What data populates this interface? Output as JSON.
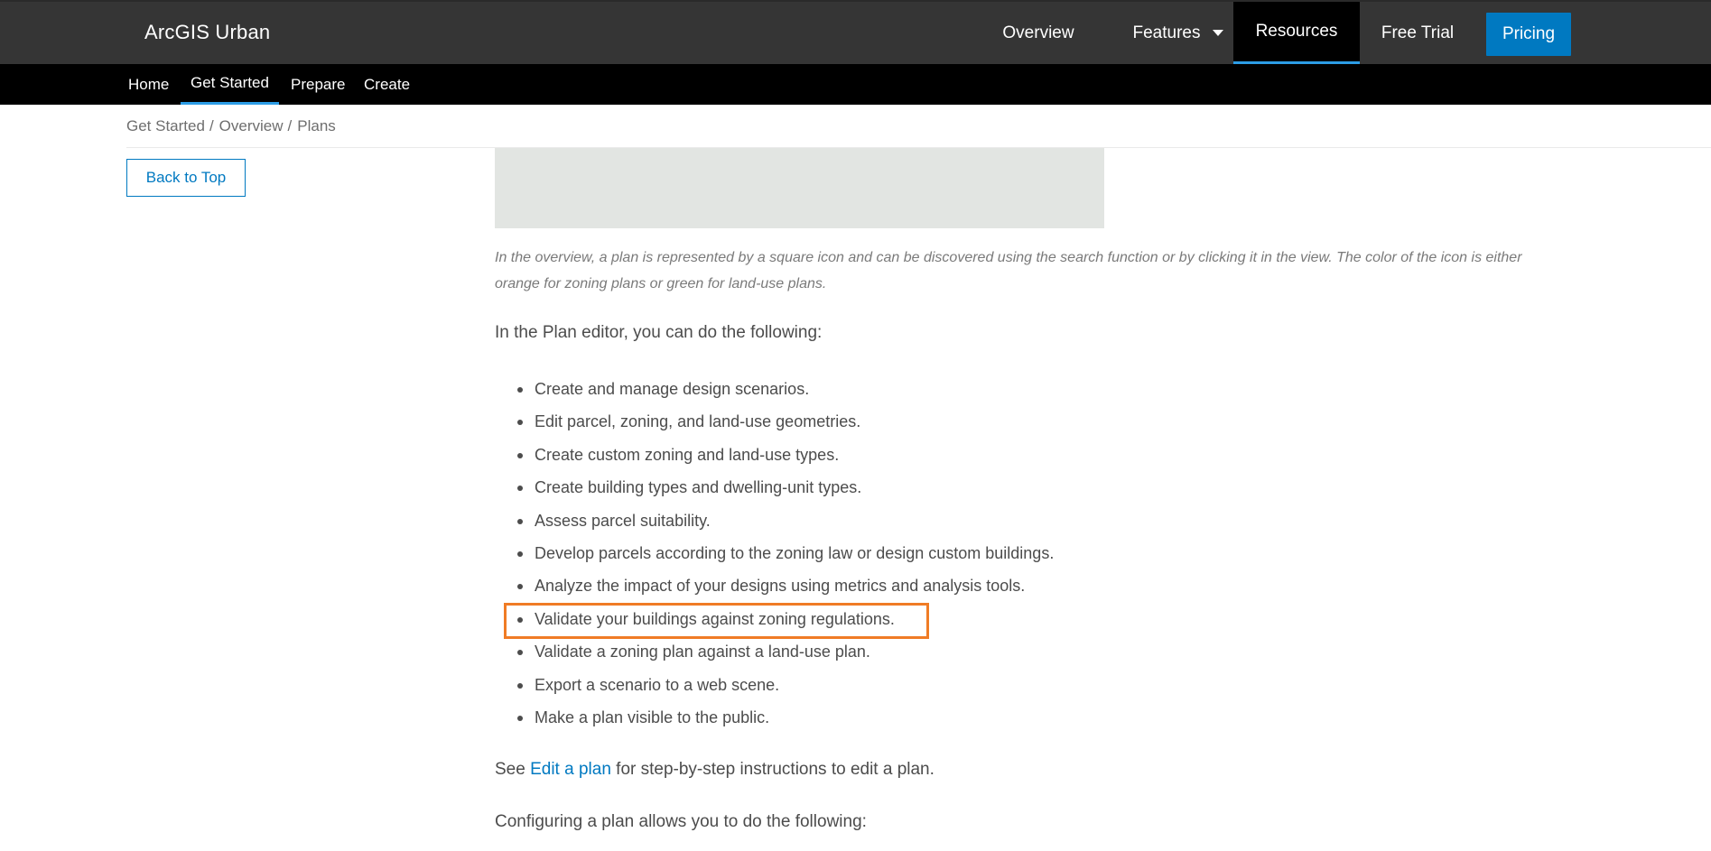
{
  "header": {
    "brand": "ArcGIS Urban",
    "nav": {
      "overview": "Overview",
      "features": "Features",
      "resources": "Resources",
      "free_trial": "Free Trial",
      "pricing": "Pricing"
    },
    "active_nav": "Resources",
    "colors": {
      "bar": "#353535",
      "active_tab": "#000000",
      "accent": "#2c9de6",
      "pricing_button": "#0079c1"
    }
  },
  "subnav": {
    "items": [
      "Home",
      "Get Started",
      "Prepare",
      "Create"
    ],
    "active": "Get Started"
  },
  "breadcrumb": [
    "Get Started",
    "Overview",
    "Plans"
  ],
  "sidebar": {
    "back_to_top": "Back to Top"
  },
  "main": {
    "caption": "In the overview, a plan is represented by a square icon and can be discovered using the search function or by clicking it in the view. The color of the icon is either orange for zoning plans or green for land-use plans.",
    "intro": "In the Plan editor, you can do the following:",
    "features": [
      "Create and manage design scenarios.",
      "Edit parcel, zoning, and land-use geometries.",
      "Create custom zoning and land-use types.",
      "Create building types and dwelling-unit types.",
      "Assess parcel suitability.",
      "Develop parcels according to the zoning law or design custom buildings.",
      "Analyze the impact of your designs using metrics and analysis tools.",
      "Validate your buildings against zoning regulations.",
      "Validate a zoning plan against a land-use plan.",
      "Export a scenario to a web scene.",
      "Make a plan visible to the public."
    ],
    "highlighted_feature_index": 7,
    "highlight_color": "#f07c25",
    "see_prefix": "See",
    "see_link": "Edit a plan",
    "see_suffix": "for step-by-step instructions to edit a plan.",
    "config_intro": "Configuring a plan allows you to do the following:"
  }
}
